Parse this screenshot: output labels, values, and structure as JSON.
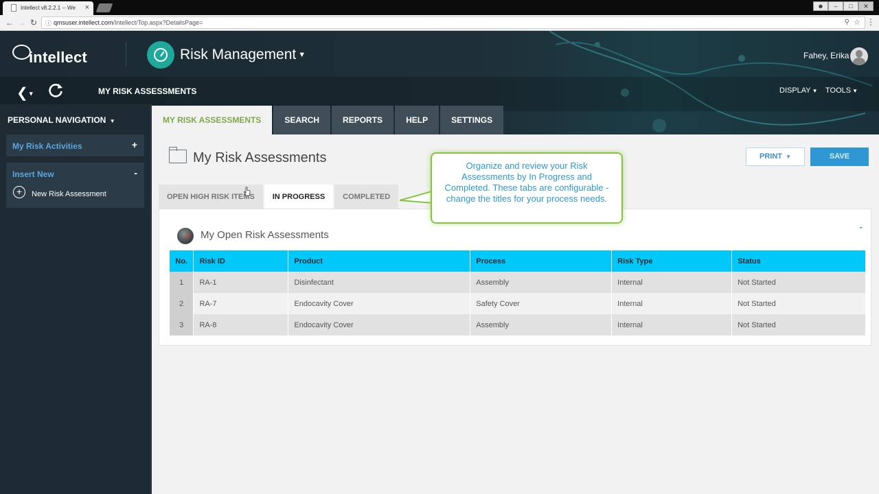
{
  "browser": {
    "tab_title": "Intellect v8.2.2.1 -- We",
    "tab_close": "×",
    "url_host": "qmsuser.intellect.com",
    "url_path": "/Intellect/Top.aspx?DetailsPage="
  },
  "app": {
    "logo_text": "intellect",
    "module_title": "Risk Management",
    "user_name": "Fahey, Erika",
    "breadcrumb_title": "MY RISK ASSESSMENTS",
    "display_menu": "DISPLAY",
    "tools_menu": "TOOLS"
  },
  "topnav": {
    "tabs": [
      {
        "label": "MY RISK ASSESSMENTS"
      },
      {
        "label": "SEARCH"
      },
      {
        "label": "REPORTS"
      },
      {
        "label": "HELP"
      },
      {
        "label": "SETTINGS"
      }
    ]
  },
  "sidebar": {
    "title": "PERSONAL NAVIGATION",
    "my_risk_activities": {
      "label": "My Risk Activities",
      "toggle": "+"
    },
    "insert_new": {
      "label": "Insert New",
      "toggle": "-",
      "item": "New Risk Assessment"
    }
  },
  "main": {
    "page_title": "My Risk Assessments",
    "print_label": "PRINT",
    "save_label": "SAVE",
    "subtabs": [
      {
        "label": "OPEN HIGH RISK ITEMS"
      },
      {
        "label": "IN PROGRESS"
      },
      {
        "label": "COMPLETED"
      }
    ],
    "panel_title": "My Open Risk Assessments",
    "panel_collapse": "-",
    "table": {
      "headers": [
        "No.",
        "Risk ID",
        "Product",
        "Process",
        "Risk Type",
        "Status"
      ],
      "rows": [
        [
          "1",
          "RA-1",
          "Disinfectant",
          "Assembly",
          "Internal",
          "Not Started"
        ],
        [
          "2",
          "RA-7",
          "Endocavity Cover",
          "Safety Cover",
          "Internal",
          "Not Started"
        ],
        [
          "3",
          "RA-8",
          "Endocavity Cover",
          "Assembly",
          "Internal",
          "Not Started"
        ]
      ]
    }
  },
  "callout": {
    "text": "Organize and review your Risk Assessments by In Progress and Completed.  These tabs are configurable - change the titles for your process needs."
  },
  "colors": {
    "accent_green": "#7ea84a",
    "table_header": "#00c8f8",
    "save_button": "#2f97d4",
    "callout_border": "#86c440"
  },
  "icons": [
    "page-icon",
    "back-arrow-icon",
    "forward-arrow-icon",
    "reload-icon",
    "info-icon",
    "zoom-icon",
    "star-icon",
    "menu-icon",
    "chat-bubble-logo-icon",
    "gauge-icon",
    "user-avatar-icon",
    "chevron-left-icon",
    "refresh-icon",
    "plus-circle-icon",
    "folder-icon",
    "speedometer-icon",
    "cursor-icon"
  ]
}
